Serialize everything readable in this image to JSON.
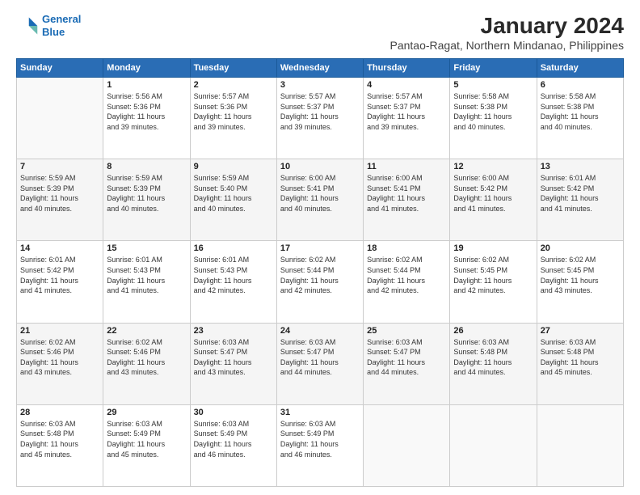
{
  "logo": {
    "line1": "General",
    "line2": "Blue"
  },
  "title": "January 2024",
  "subtitle": "Pantao-Ragat, Northern Mindanao, Philippines",
  "days_of_week": [
    "Sunday",
    "Monday",
    "Tuesday",
    "Wednesday",
    "Thursday",
    "Friday",
    "Saturday"
  ],
  "weeks": [
    [
      {
        "num": "",
        "info": ""
      },
      {
        "num": "1",
        "info": "Sunrise: 5:56 AM\nSunset: 5:36 PM\nDaylight: 11 hours\nand 39 minutes."
      },
      {
        "num": "2",
        "info": "Sunrise: 5:57 AM\nSunset: 5:36 PM\nDaylight: 11 hours\nand 39 minutes."
      },
      {
        "num": "3",
        "info": "Sunrise: 5:57 AM\nSunset: 5:37 PM\nDaylight: 11 hours\nand 39 minutes."
      },
      {
        "num": "4",
        "info": "Sunrise: 5:57 AM\nSunset: 5:37 PM\nDaylight: 11 hours\nand 39 minutes."
      },
      {
        "num": "5",
        "info": "Sunrise: 5:58 AM\nSunset: 5:38 PM\nDaylight: 11 hours\nand 40 minutes."
      },
      {
        "num": "6",
        "info": "Sunrise: 5:58 AM\nSunset: 5:38 PM\nDaylight: 11 hours\nand 40 minutes."
      }
    ],
    [
      {
        "num": "7",
        "info": "Sunrise: 5:59 AM\nSunset: 5:39 PM\nDaylight: 11 hours\nand 40 minutes."
      },
      {
        "num": "8",
        "info": "Sunrise: 5:59 AM\nSunset: 5:39 PM\nDaylight: 11 hours\nand 40 minutes."
      },
      {
        "num": "9",
        "info": "Sunrise: 5:59 AM\nSunset: 5:40 PM\nDaylight: 11 hours\nand 40 minutes."
      },
      {
        "num": "10",
        "info": "Sunrise: 6:00 AM\nSunset: 5:41 PM\nDaylight: 11 hours\nand 40 minutes."
      },
      {
        "num": "11",
        "info": "Sunrise: 6:00 AM\nSunset: 5:41 PM\nDaylight: 11 hours\nand 41 minutes."
      },
      {
        "num": "12",
        "info": "Sunrise: 6:00 AM\nSunset: 5:42 PM\nDaylight: 11 hours\nand 41 minutes."
      },
      {
        "num": "13",
        "info": "Sunrise: 6:01 AM\nSunset: 5:42 PM\nDaylight: 11 hours\nand 41 minutes."
      }
    ],
    [
      {
        "num": "14",
        "info": "Sunrise: 6:01 AM\nSunset: 5:42 PM\nDaylight: 11 hours\nand 41 minutes."
      },
      {
        "num": "15",
        "info": "Sunrise: 6:01 AM\nSunset: 5:43 PM\nDaylight: 11 hours\nand 41 minutes."
      },
      {
        "num": "16",
        "info": "Sunrise: 6:01 AM\nSunset: 5:43 PM\nDaylight: 11 hours\nand 42 minutes."
      },
      {
        "num": "17",
        "info": "Sunrise: 6:02 AM\nSunset: 5:44 PM\nDaylight: 11 hours\nand 42 minutes."
      },
      {
        "num": "18",
        "info": "Sunrise: 6:02 AM\nSunset: 5:44 PM\nDaylight: 11 hours\nand 42 minutes."
      },
      {
        "num": "19",
        "info": "Sunrise: 6:02 AM\nSunset: 5:45 PM\nDaylight: 11 hours\nand 42 minutes."
      },
      {
        "num": "20",
        "info": "Sunrise: 6:02 AM\nSunset: 5:45 PM\nDaylight: 11 hours\nand 43 minutes."
      }
    ],
    [
      {
        "num": "21",
        "info": "Sunrise: 6:02 AM\nSunset: 5:46 PM\nDaylight: 11 hours\nand 43 minutes."
      },
      {
        "num": "22",
        "info": "Sunrise: 6:02 AM\nSunset: 5:46 PM\nDaylight: 11 hours\nand 43 minutes."
      },
      {
        "num": "23",
        "info": "Sunrise: 6:03 AM\nSunset: 5:47 PM\nDaylight: 11 hours\nand 43 minutes."
      },
      {
        "num": "24",
        "info": "Sunrise: 6:03 AM\nSunset: 5:47 PM\nDaylight: 11 hours\nand 44 minutes."
      },
      {
        "num": "25",
        "info": "Sunrise: 6:03 AM\nSunset: 5:47 PM\nDaylight: 11 hours\nand 44 minutes."
      },
      {
        "num": "26",
        "info": "Sunrise: 6:03 AM\nSunset: 5:48 PM\nDaylight: 11 hours\nand 44 minutes."
      },
      {
        "num": "27",
        "info": "Sunrise: 6:03 AM\nSunset: 5:48 PM\nDaylight: 11 hours\nand 45 minutes."
      }
    ],
    [
      {
        "num": "28",
        "info": "Sunrise: 6:03 AM\nSunset: 5:48 PM\nDaylight: 11 hours\nand 45 minutes."
      },
      {
        "num": "29",
        "info": "Sunrise: 6:03 AM\nSunset: 5:49 PM\nDaylight: 11 hours\nand 45 minutes."
      },
      {
        "num": "30",
        "info": "Sunrise: 6:03 AM\nSunset: 5:49 PM\nDaylight: 11 hours\nand 46 minutes."
      },
      {
        "num": "31",
        "info": "Sunrise: 6:03 AM\nSunset: 5:49 PM\nDaylight: 11 hours\nand 46 minutes."
      },
      {
        "num": "",
        "info": ""
      },
      {
        "num": "",
        "info": ""
      },
      {
        "num": "",
        "info": ""
      }
    ]
  ]
}
